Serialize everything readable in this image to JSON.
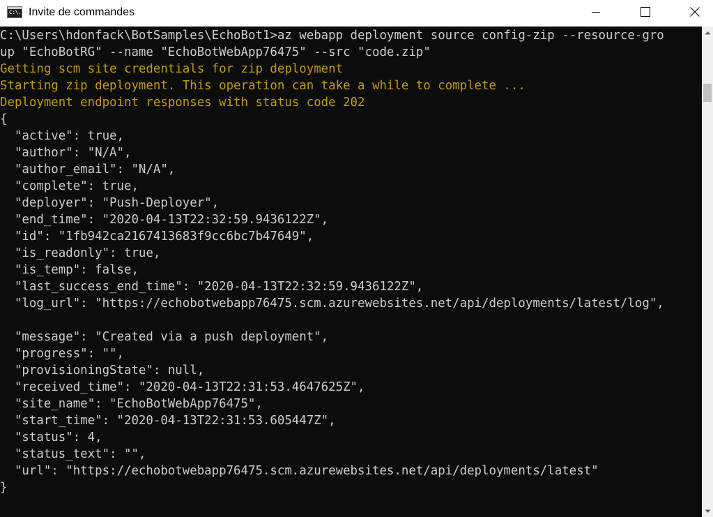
{
  "window": {
    "title": "Invite de commandes",
    "app_icon_glyph": "C:\\.",
    "icons": {
      "app": "command-prompt-icon",
      "minimize": "minimize-icon",
      "maximize": "maximize-icon",
      "close": "close-icon",
      "scroll_up": "arrow-up-icon",
      "scroll_down": "arrow-down-icon"
    }
  },
  "colors": {
    "console_background": "#0c0c0c",
    "text_default": "#cccccc",
    "text_warning": "#c19c00",
    "titlebar": "#ffffff"
  },
  "console": {
    "lines": [
      {
        "text": "C:\\Users\\hdonfack\\BotSamples\\EchoBot1>az webapp deployment source config-zip --resource-gro",
        "style": "default"
      },
      {
        "text": "up \"EchoBotRG\" --name \"EchoBotWebApp76475\" --src \"code.zip\"",
        "style": "default"
      },
      {
        "text": "Getting scm site credentials for zip deployment",
        "style": "warning"
      },
      {
        "text": "Starting zip deployment. This operation can take a while to complete ...",
        "style": "warning"
      },
      {
        "text": "Deployment endpoint responses with status code 202",
        "style": "warning"
      },
      {
        "text": "{",
        "style": "default"
      },
      {
        "text": "  \"active\": true,",
        "style": "default"
      },
      {
        "text": "  \"author\": \"N/A\",",
        "style": "default"
      },
      {
        "text": "  \"author_email\": \"N/A\",",
        "style": "default"
      },
      {
        "text": "  \"complete\": true,",
        "style": "default"
      },
      {
        "text": "  \"deployer\": \"Push-Deployer\",",
        "style": "default"
      },
      {
        "text": "  \"end_time\": \"2020-04-13T22:32:59.9436122Z\",",
        "style": "default"
      },
      {
        "text": "  \"id\": \"1fb942ca2167413683f9cc6bc7b47649\",",
        "style": "default"
      },
      {
        "text": "  \"is_readonly\": true,",
        "style": "default"
      },
      {
        "text": "  \"is_temp\": false,",
        "style": "default"
      },
      {
        "text": "  \"last_success_end_time\": \"2020-04-13T22:32:59.9436122Z\",",
        "style": "default"
      },
      {
        "text": "  \"log_url\": \"https://echobotwebapp76475.scm.azurewebsites.net/api/deployments/latest/log\",",
        "style": "default"
      },
      {
        "text": "",
        "style": "default"
      },
      {
        "text": "  \"message\": \"Created via a push deployment\",",
        "style": "default"
      },
      {
        "text": "  \"progress\": \"\",",
        "style": "default"
      },
      {
        "text": "  \"provisioningState\": null,",
        "style": "default"
      },
      {
        "text": "  \"received_time\": \"2020-04-13T22:31:53.4647625Z\",",
        "style": "default"
      },
      {
        "text": "  \"site_name\": \"EchoBotWebApp76475\",",
        "style": "default"
      },
      {
        "text": "  \"start_time\": \"2020-04-13T22:31:53.605447Z\",",
        "style": "default"
      },
      {
        "text": "  \"status\": 4,",
        "style": "default"
      },
      {
        "text": "  \"status_text\": \"\",",
        "style": "default"
      },
      {
        "text": "  \"url\": \"https://echobotwebapp76475.scm.azurewebsites.net/api/deployments/latest\"",
        "style": "default"
      },
      {
        "text": "}",
        "style": "default"
      }
    ]
  }
}
